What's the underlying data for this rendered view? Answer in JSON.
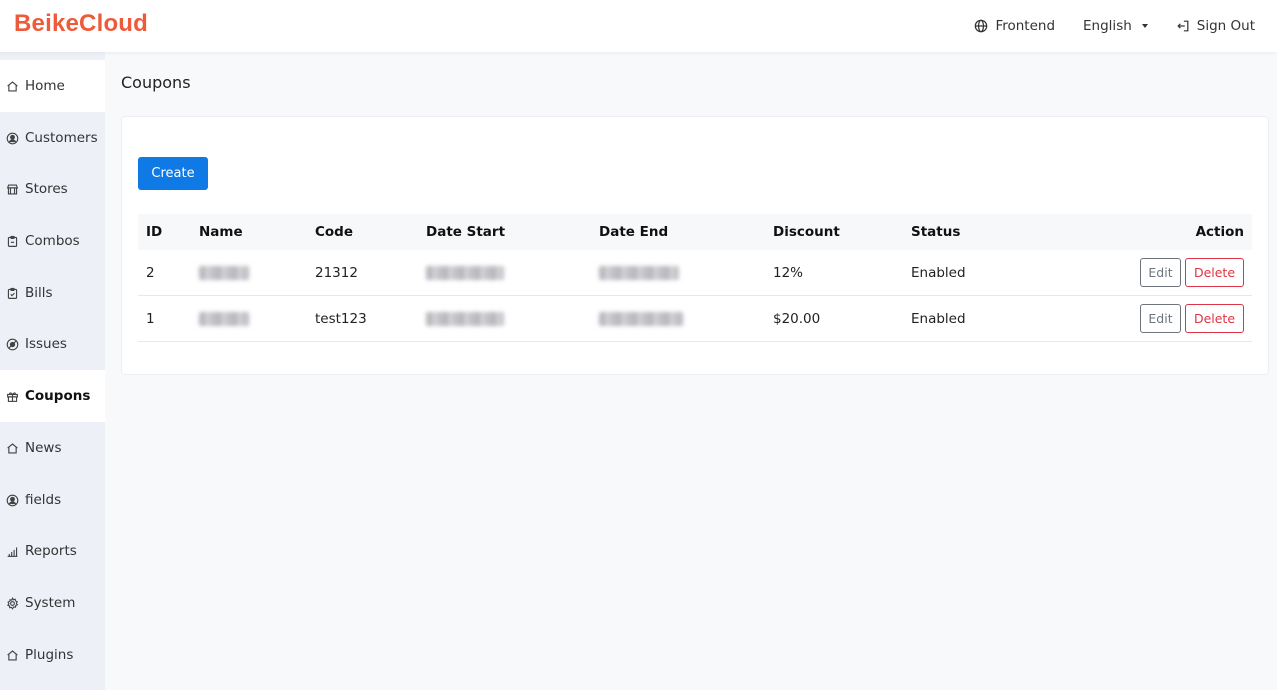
{
  "header": {
    "logo": "BeikeCloud",
    "frontend_label": "Frontend",
    "language_label": "English",
    "signout_label": "Sign Out"
  },
  "sidebar": {
    "items": [
      {
        "label": "Home",
        "icon": "home-icon"
      },
      {
        "label": "Customers",
        "icon": "user-circle-icon"
      },
      {
        "label": "Stores",
        "icon": "store-icon"
      },
      {
        "label": "Combos",
        "icon": "clipboard-icon"
      },
      {
        "label": "Bills",
        "icon": "clipboard-check-icon"
      },
      {
        "label": "Issues",
        "icon": "life-ring-icon"
      },
      {
        "label": "Coupons",
        "icon": "gift-icon",
        "active": true
      },
      {
        "label": "News",
        "icon": "home-icon"
      },
      {
        "label": "fields",
        "icon": "user-circle-icon"
      },
      {
        "label": "Reports",
        "icon": "bar-chart-icon"
      },
      {
        "label": "System",
        "icon": "gear-icon"
      },
      {
        "label": "Plugins",
        "icon": "home-icon"
      }
    ]
  },
  "page": {
    "title": "Coupons",
    "create_label": "Create"
  },
  "table": {
    "headers": [
      "ID",
      "Name",
      "Code",
      "Date Start",
      "Date End",
      "Discount",
      "Status",
      "Action"
    ],
    "rows": [
      {
        "id": "2",
        "code": "21312",
        "discount": "12%",
        "status": "Enabled"
      },
      {
        "id": "1",
        "code": "test123",
        "discount": "$20.00",
        "status": "Enabled"
      }
    ],
    "edit_label": "Edit",
    "delete_label": "Delete"
  },
  "colors": {
    "brand": "#ee5b3b",
    "primary": "#0f7ae5",
    "danger": "#dc3545",
    "secondary": "#6c757d"
  }
}
